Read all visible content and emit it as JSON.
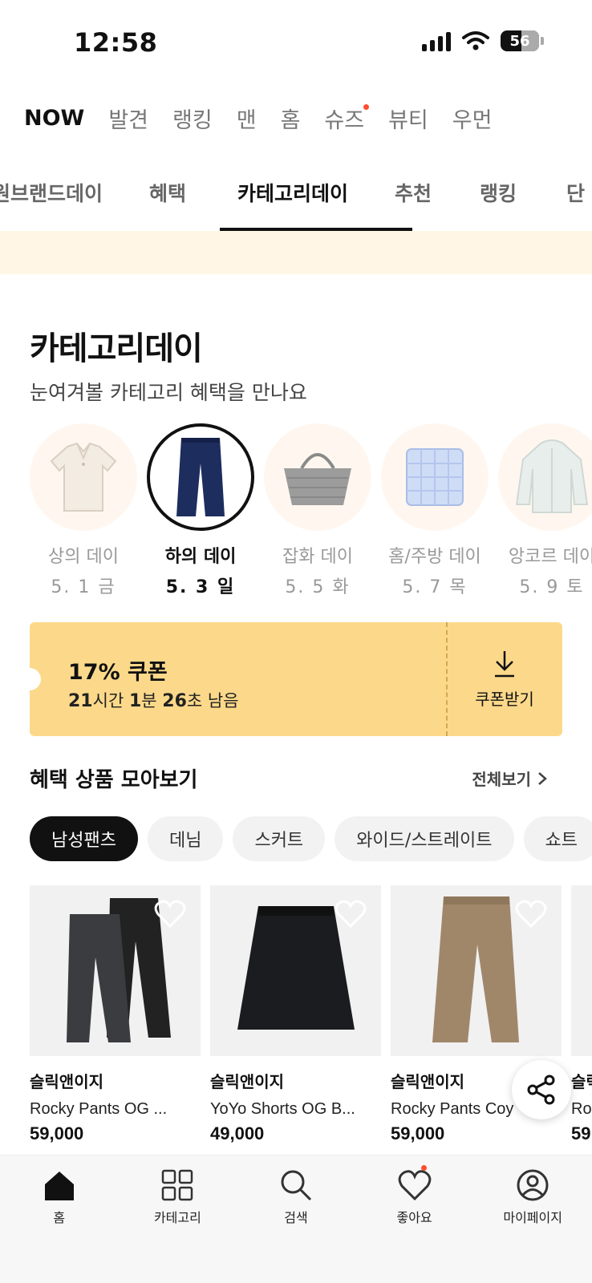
{
  "status": {
    "time": "12:58",
    "battery": "56"
  },
  "top_tabs": [
    {
      "label": "NOW",
      "active": true
    },
    {
      "label": "발견"
    },
    {
      "label": "랭킹"
    },
    {
      "label": "맨"
    },
    {
      "label": "홈"
    },
    {
      "label": "슈즈",
      "dot": true
    },
    {
      "label": "뷰티"
    },
    {
      "label": "우먼"
    }
  ],
  "sub_tabs": [
    {
      "label": "원브랜드데이"
    },
    {
      "label": "혜택"
    },
    {
      "label": "카테고리데이",
      "active": true
    },
    {
      "label": "추천"
    },
    {
      "label": "랭킹"
    },
    {
      "label": "단"
    }
  ],
  "section": {
    "title": "카테고리데이",
    "subtitle": "눈여겨볼 카테고리 혜택을 만나요"
  },
  "days": [
    {
      "label": "상의 데이",
      "date": "5. 1 금",
      "icon": "shirt"
    },
    {
      "label": "하의 데이",
      "date": "5. 3 일",
      "icon": "pants",
      "active": true
    },
    {
      "label": "잡화 데이",
      "date": "5. 5 화",
      "icon": "bag"
    },
    {
      "label": "홈/주방 데이",
      "date": "5. 7 목",
      "icon": "pillow"
    },
    {
      "label": "앙코르 데이",
      "date": "5. 9 토",
      "icon": "jacket"
    }
  ],
  "coupon": {
    "title": "17% 쿠폰",
    "timer_hours": "21",
    "timer_hours_unit": "시간 ",
    "timer_minutes": "1",
    "timer_minutes_unit": "분 ",
    "timer_seconds": "26",
    "timer_seconds_unit": "초 남음",
    "button_label": "쿠폰받기"
  },
  "benefit": {
    "title": "혜택 상품 모아보기",
    "see_all": "전체보기"
  },
  "chips": [
    {
      "label": "남성팬츠",
      "active": true
    },
    {
      "label": "데님"
    },
    {
      "label": "스커트"
    },
    {
      "label": "와이드/스트레이트"
    },
    {
      "label": "쇼트"
    }
  ],
  "products": [
    {
      "brand": "슬릭앤이지",
      "name": "Rocky Pants OG ...",
      "price": "59,000"
    },
    {
      "brand": "슬릭앤이지",
      "name": "YoYo Shorts OG B...",
      "price": "49,000"
    },
    {
      "brand": "슬릭앤이지",
      "name": "Rocky Pants Coy",
      "price": "59,000"
    },
    {
      "brand": "슬릭",
      "name": "Ro",
      "price": "59"
    }
  ],
  "bottom_nav": [
    {
      "label": "홈",
      "icon": "home-icon",
      "active": true
    },
    {
      "label": "카테고리",
      "icon": "category-icon"
    },
    {
      "label": "검색",
      "icon": "search-icon"
    },
    {
      "label": "좋아요",
      "icon": "heart-icon",
      "dot": true
    },
    {
      "label": "마이페이지",
      "icon": "profile-icon"
    }
  ],
  "colors": {
    "accent_dot": "#ff4d2d",
    "coupon_bg": "#fcd98a",
    "promo_band": "#fff6e6"
  }
}
